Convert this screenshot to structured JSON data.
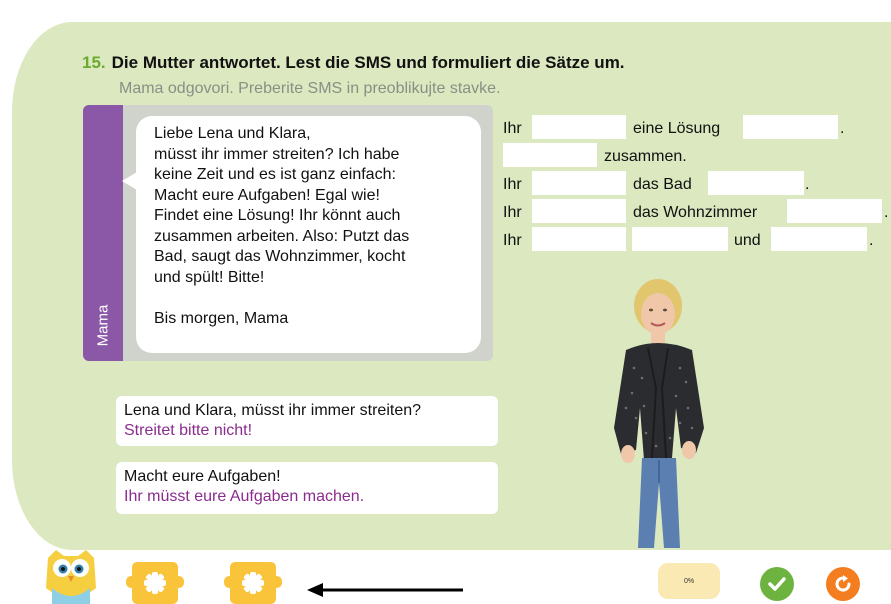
{
  "exercise": {
    "number": "15.",
    "title": "Die Mutter antwortet. Lest die SMS und formuliert die Sätze um.",
    "subtitle": "Mama odgovori. Preberite SMS in preoblikujte stavke."
  },
  "sms": {
    "sender": "Mama",
    "lines": [
      "Liebe Lena und Klara,",
      "müsst ihr immer streiten? Ich habe",
      "keine Zeit und es ist ganz einfach:",
      "Macht eure Aufgaben! Egal wie!",
      "Findet eine Lösung! Ihr könnt auch",
      "zusammen arbeiten. Also: Putzt das",
      "Bad, saugt das Wohnzimmer, kocht",
      "und spült! Bitte!"
    ],
    "closing": "Bis morgen, Mama"
  },
  "examples": [
    {
      "prompt": "Lena und Klara, müsst ihr immer streiten?",
      "answer": "Streitet bitte nicht!"
    },
    {
      "prompt": "Macht eure Aufgaben!",
      "answer": "Ihr müsst eure Aufgaben machen."
    }
  ],
  "exercise_lines": [
    {
      "words": [
        "Ihr",
        "eine Lösung",
        "."
      ]
    },
    {
      "words": [
        "zusammen."
      ]
    },
    {
      "words": [
        "Ihr",
        "das Bad",
        "."
      ]
    },
    {
      "words": [
        "Ihr",
        "das Wohnzimmer",
        "."
      ]
    },
    {
      "words": [
        "Ihr",
        "und",
        "."
      ]
    }
  ],
  "footer": {
    "progress": "0%",
    "arrow_direction": "left",
    "icons": {
      "mascot": "owl-icon",
      "hint1": "puzzle-piece-icon",
      "hint2": "puzzle-piece-icon",
      "check": "check-icon",
      "reset": "reset-icon"
    }
  },
  "colors": {
    "panel": "#dbe8c0",
    "number": "#6aaa2c",
    "sender_tab": "#8a58a7",
    "answer": "#8a2c8e",
    "puzzle": "#f9c33a",
    "check": "#6cb33f",
    "reset": "#f47d20",
    "progress_bg": "#fbe9b3"
  }
}
